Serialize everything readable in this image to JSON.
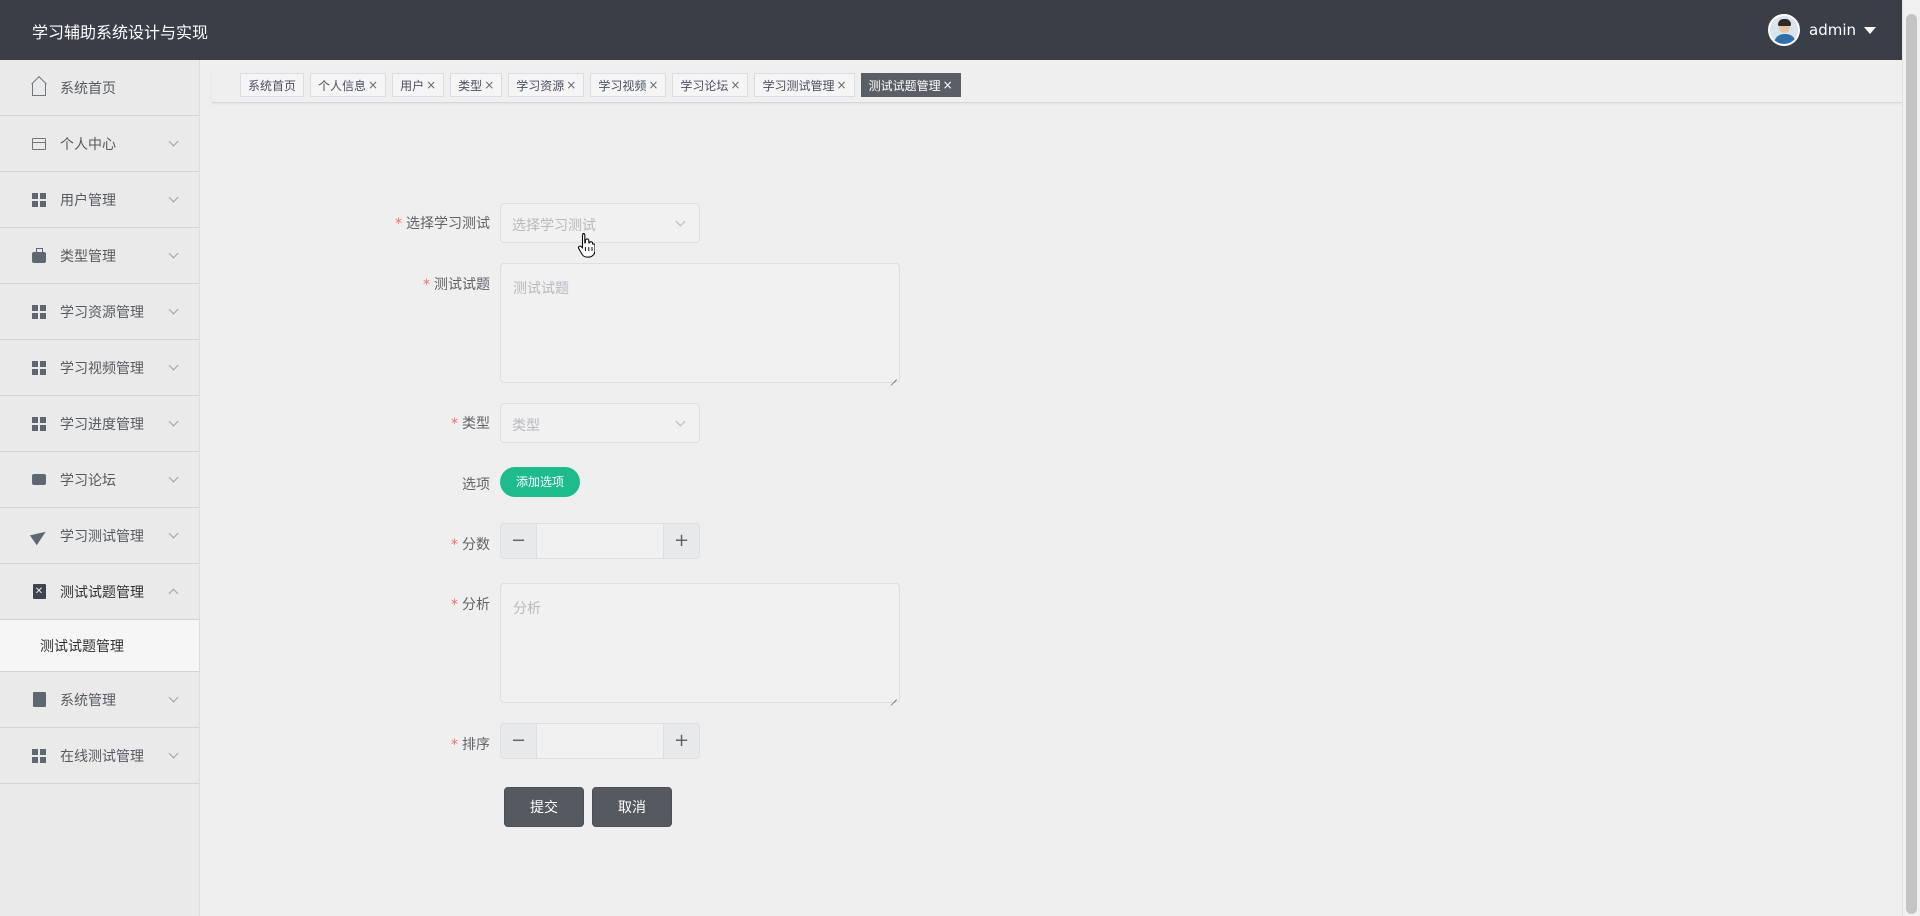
{
  "header": {
    "app_title": "学习辅助系统设计与实现",
    "username": "admin"
  },
  "sidebar": {
    "items": [
      {
        "label": "系统首页",
        "icon": "home-icon"
      },
      {
        "label": "个人中心",
        "icon": "wallet-icon"
      },
      {
        "label": "用户管理",
        "icon": "grid-icon"
      },
      {
        "label": "类型管理",
        "icon": "briefcase-icon"
      },
      {
        "label": "学习资源管理",
        "icon": "grid-icon"
      },
      {
        "label": "学习视频管理",
        "icon": "grid-icon"
      },
      {
        "label": "学习进度管理",
        "icon": "grid-icon"
      },
      {
        "label": "学习论坛",
        "icon": "chat-icon"
      },
      {
        "label": "学习测试管理",
        "icon": "send-icon"
      },
      {
        "label": "测试试题管理",
        "icon": "clipboard-x-icon"
      },
      {
        "label": "系统管理",
        "icon": "clipboard-check-icon"
      },
      {
        "label": "在线测试管理",
        "icon": "grid-icon"
      }
    ],
    "submenu": {
      "label": "测试试题管理"
    }
  },
  "tabs": [
    {
      "label": "系统首页",
      "closable": false
    },
    {
      "label": "个人信息",
      "closable": true
    },
    {
      "label": "用户",
      "closable": true
    },
    {
      "label": "类型",
      "closable": true
    },
    {
      "label": "学习资源",
      "closable": true
    },
    {
      "label": "学习视频",
      "closable": true
    },
    {
      "label": "学习论坛",
      "closable": true
    },
    {
      "label": "学习测试管理",
      "closable": true
    },
    {
      "label": "测试试题管理",
      "closable": true,
      "active": true
    }
  ],
  "tab_close_glyph": "×",
  "form": {
    "required_mark": "*",
    "test_select": {
      "label": "选择学习测试",
      "placeholder": "选择学习测试"
    },
    "question": {
      "label": "测试试题",
      "placeholder": "测试试题"
    },
    "type": {
      "label": "类型",
      "placeholder": "类型"
    },
    "options": {
      "label": "选项",
      "add_button": "添加选项"
    },
    "score": {
      "label": "分数",
      "value": "",
      "minus": "−",
      "plus": "+"
    },
    "analysis": {
      "label": "分析",
      "placeholder": "分析"
    },
    "sort": {
      "label": "排序",
      "value": "",
      "minus": "−",
      "plus": "+"
    },
    "submit_label": "提交",
    "cancel_label": "取消"
  },
  "colors": {
    "header_bg": "#3a3f47",
    "add_button": "#1ebc8c",
    "active_tab": "#5a5f66",
    "required": "#f56c6c"
  }
}
